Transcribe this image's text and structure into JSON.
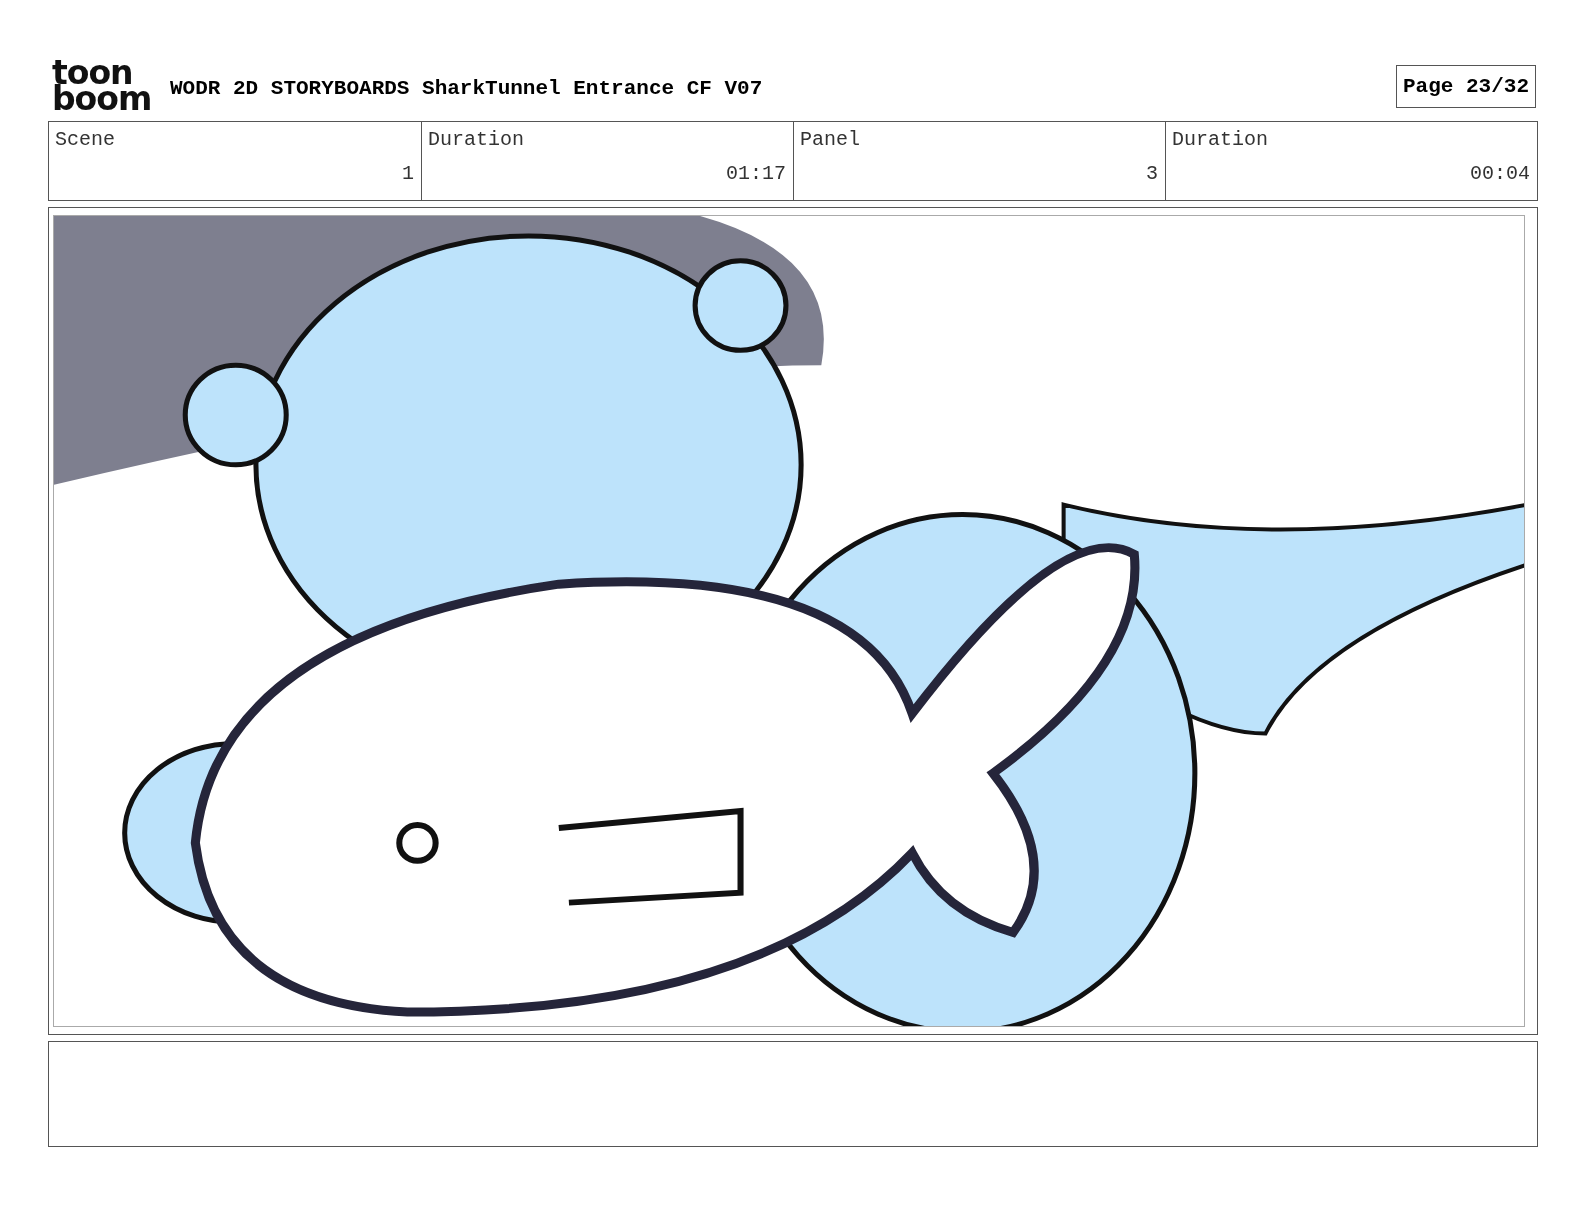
{
  "header": {
    "logo": [
      "toon",
      "boom"
    ],
    "title": "WODR 2D STORYBOARDS SharkTunnel Entrance CF V07",
    "page": "Page 23/32"
  },
  "info": {
    "columns": [
      "Scene",
      "Duration",
      "Panel",
      "Duration"
    ],
    "values": [
      "1",
      "01:17",
      "3",
      "00:04"
    ]
  }
}
